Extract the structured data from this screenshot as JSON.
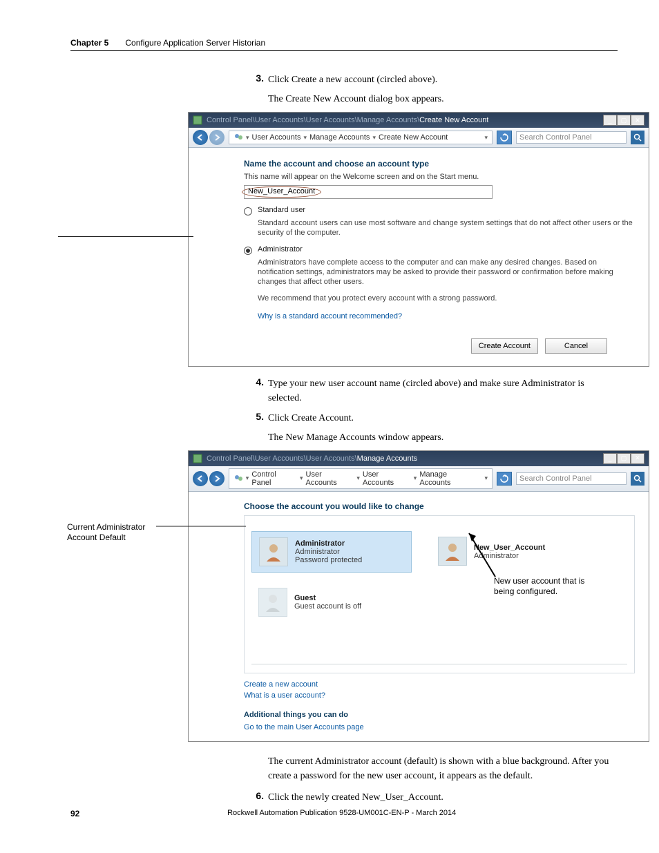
{
  "header": {
    "chapter": "Chapter 5",
    "title": "Configure Application Server Historian"
  },
  "steps": {
    "s3": {
      "num": "3.",
      "text": "Click Create a new account (circled above)."
    },
    "s3_note": "The Create New Account dialog box appears.",
    "s4": {
      "num": "4.",
      "text": "Type your new user account name (circled above) and make sure Administrator is selected."
    },
    "s5": {
      "num": "5.",
      "text": "Click Create Account."
    },
    "s5_note": "The New Manage Accounts window appears.",
    "post2": "The current Administrator account (default) is shown with a blue background. After you create a password for the new user account, it appears as the default.",
    "s6": {
      "num": "6.",
      "text": "Click the newly created New_User_Account."
    }
  },
  "win1": {
    "title_prefix": "Control Panel\\User Accounts\\User Accounts\\Manage Accounts\\",
    "title_active": "Create New Account",
    "breadcrumb": [
      "User Accounts",
      "Manage Accounts",
      "Create New Account"
    ],
    "search_placeholder": "Search Control Panel",
    "heading": "Name the account and choose an account type",
    "desc": "This name will appear on the Welcome screen and on the Start menu.",
    "input_value": "New_User_Account",
    "opt1_label": "Standard user",
    "opt1_desc": "Standard account users can use most software and change system settings that do not affect other users or the security of the computer.",
    "opt2_label": "Administrator",
    "opt2_desc": "Administrators have complete access to the computer and can make any desired changes. Based on notification settings, administrators may be asked to provide their password or confirmation before making changes that affect other users.",
    "recommend": "We recommend that you protect every account with a strong password.",
    "why_link": "Why is a standard account recommended?",
    "btn_create": "Create Account",
    "btn_cancel": "Cancel"
  },
  "win2": {
    "title_prefix": "Control Panel\\User Accounts\\User Accounts\\",
    "title_active": "Manage Accounts",
    "breadcrumb": [
      "Control Panel",
      "User Accounts",
      "User Accounts",
      "Manage Accounts"
    ],
    "search_placeholder": "Search Control Panel",
    "heading": "Choose the account you would like to change",
    "admin_name": "Administrator",
    "admin_role": "Administrator",
    "admin_pw": "Password protected",
    "new_name": "New_User_Account",
    "new_role": "Administrator",
    "guest_name": "Guest",
    "guest_status": "Guest account is off",
    "link_create": "Create a new account",
    "link_what": "What is a user account?",
    "additional_heading": "Additional things you can do",
    "link_main": "Go to the main User Accounts page"
  },
  "callouts": {
    "left": "Current Administrator Account Default",
    "right": "New user account that is being configured."
  },
  "footer": {
    "page": "92",
    "pub": "Rockwell Automation Publication 9528-UM001C-EN-P - March 2014"
  }
}
